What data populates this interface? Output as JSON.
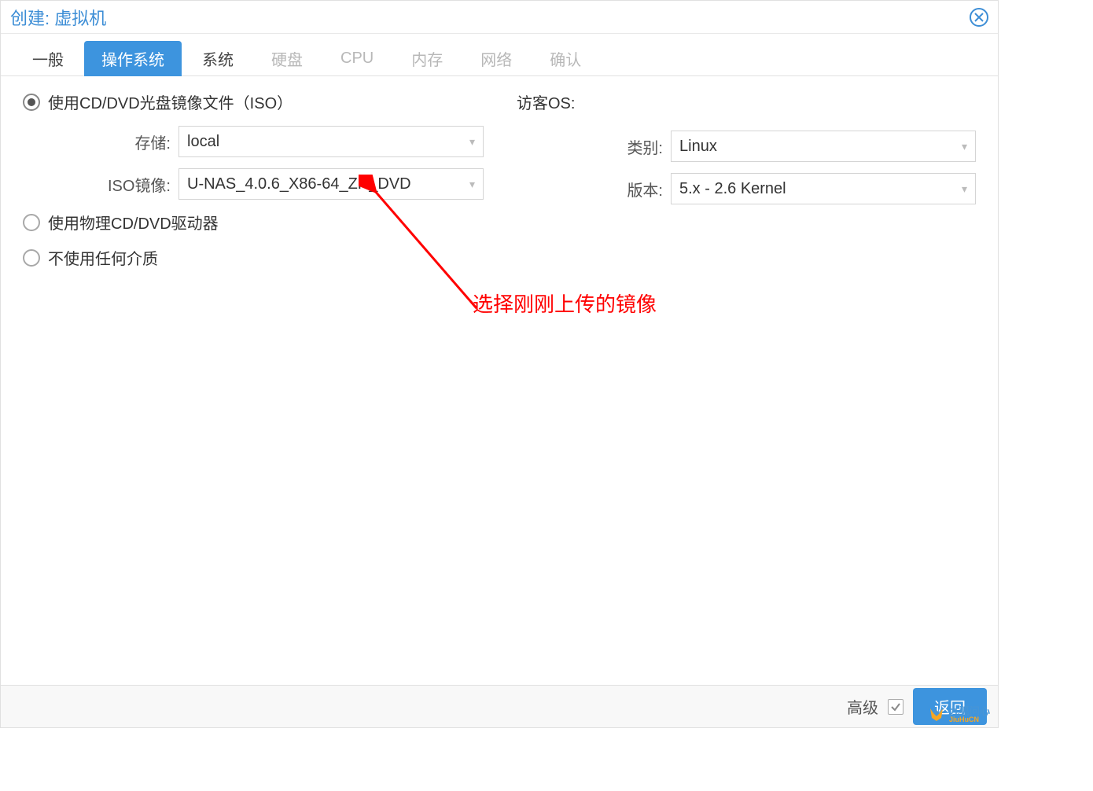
{
  "title": "创建: 虚拟机",
  "tabs": {
    "general": "一般",
    "os": "操作系统",
    "system": "系统",
    "disk": "硬盘",
    "cpu": "CPU",
    "memory": "内存",
    "network": "网络",
    "confirm": "确认"
  },
  "radio": {
    "iso": "使用CD/DVD光盘镜像文件（ISO）",
    "physical": "使用物理CD/DVD驱动器",
    "none": "不使用任何介质"
  },
  "storage_label": "存储:",
  "storage_value": "local",
  "iso_label": "ISO镜像:",
  "iso_value": "U-NAS_4.0.6_X86-64_ZH_DVD",
  "guest_os_header": "访客OS:",
  "type_label": "类别:",
  "type_value": "Linux",
  "version_label": "版本:",
  "version_value": "5.x - 2.6 Kernel",
  "annotation": "选择刚刚上传的镜像",
  "footer": {
    "advanced": "高级",
    "back": "返回"
  },
  "watermark": {
    "cn": "九狐问心",
    "en": "JiuHuCN"
  }
}
